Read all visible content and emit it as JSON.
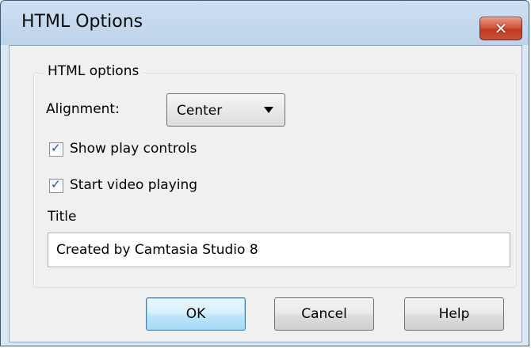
{
  "window": {
    "title": "HTML Options"
  },
  "group": {
    "label": "HTML options"
  },
  "alignment": {
    "label": "Alignment:",
    "value": "Center"
  },
  "checkboxes": [
    {
      "label": "Show play controls",
      "checked": true
    },
    {
      "label": "Start video playing",
      "checked": true
    }
  ],
  "title_field": {
    "label": "Title",
    "value": "Created by Camtasia Studio 8"
  },
  "buttons": {
    "ok": "OK",
    "cancel": "Cancel",
    "help": "Help"
  },
  "icons": {
    "close": "close-icon",
    "dropdown": "dropdown-arrow-icon",
    "check": "checkmark-icon"
  },
  "colors": {
    "close_button": "#c9503a",
    "default_button": "#bee6fd",
    "titlebar": "#cfe0f2"
  }
}
